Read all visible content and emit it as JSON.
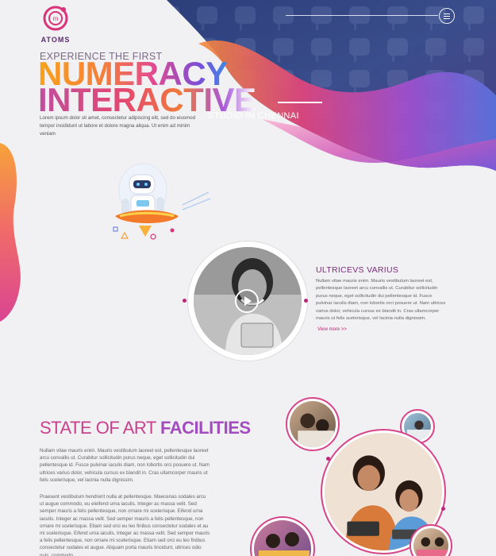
{
  "brand": {
    "name": "ATOMS"
  },
  "hero": {
    "kicker": "EXPERIENCE THE FIRST",
    "title_line1": "NUMERACY",
    "title_line2": "INTERACTIVE",
    "subtitle": "STUDIO IN CHENNAI",
    "body": "Lorem ipsum dolor sit amet, consectetur adipiscing elit, sed do eiusmod tempor incididunt ut labore et dolore magna aliqua. Ut enim ad minim veniam"
  },
  "feature": {
    "title": "ULTRICEVS VARIUS",
    "body": "Nullam vitae mauris enim. Mauris vestibulum laoreet est, pellentesque laoreet arcu convallis ut. Curabitur sollicitudin purus neque, eget sollicitudin dui pellentesque id. Fusce pulvinar iaculis diam, non lobortis orci posuere ut. Nam ultrices varius dolor, vehicula cursus ex blandit in. Cras ullamcorper mauris ut felis scelerisque, vel lacinia nulla dignissim.",
    "link": "View more >>"
  },
  "facilities": {
    "title_part1": "STATE OF ART ",
    "title_part2": "FACILITIES",
    "para1": "Nullam vitae mauris enim. Mauris vestibulum laoreet est, pellentesque laoreet arcu convallis ut. Curabitur sollicitudin purus neque, eget sollicitudin dui pellentesque id. Fusce pulvinar iaculis diam, non lobortis orci posuere ut. Nam ultrices varius dolor, vehicula cursus ex blandit in. Cras ullamcorper mauris ut felis scelerisque, vel lacinia nulla dignissim.",
    "para2": "Praesent vestibulum hendrerit nulla at pellentesque. Maecenas sodales arcu ut augue commodo, eu eleifend urna iaculis. Integer ac massa velit. Sed semper mauris a felis pellentesque, non ornare mi scelerisque. Eifend urna iaculis. Integer ac massa velit. Sed semper mauris a felis pellentesque, non ornare mi scelerisque. Etiam sed orci eu leo finibus consectetur sodales et au mi scelerisque. Eifend urna iaculis. Integer ac massa velit. Sed semper mauris a felis pellentesque, non ornare mi scelerisque. Etiam sed orci eu leo finibus consectetur sodales et augue. Aliquam porta mauris tincidunt, ultrices odio quis, commodo"
  },
  "colors": {
    "brand_pink": "#c0277a",
    "brand_purple": "#7a2e7e",
    "accent_orange": "#f47d3b"
  },
  "icons": [
    "menu-icon",
    "play-icon"
  ]
}
